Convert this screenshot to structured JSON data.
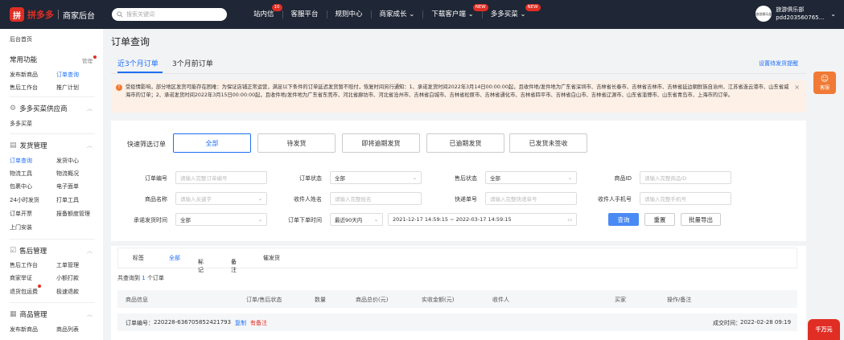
{
  "header": {
    "logo_mark": "拼",
    "logo_text": "拼多多",
    "logo_sub": "商家后台",
    "search_placeholder": "搜索关键词",
    "nav": [
      {
        "label": "站内信",
        "badge": "10"
      },
      {
        "label": "客服平台",
        "badge": ""
      },
      {
        "label": "规则中心",
        "badge": ""
      },
      {
        "label": "商家成长",
        "badge": ""
      },
      {
        "label": "下载客户端",
        "badge": "NEW"
      },
      {
        "label": "多多买菜",
        "badge": "NEW"
      }
    ],
    "nav_chevron": "⌄",
    "user": {
      "avatar_text": "旅游俱乐部",
      "name": "旅游俱乐部",
      "id": "pdd203560765..."
    }
  },
  "sidebar": {
    "home": "后台首页",
    "sections": [
      {
        "title": "常用功能",
        "icon": "",
        "extra": "管理",
        "items": [
          "发布新商品",
          "订单查询",
          "售后工作台",
          "推广计划"
        ]
      },
      {
        "title": "多多买菜供应商",
        "icon": "⚙",
        "items": [
          "多多买菜"
        ]
      },
      {
        "title": "发货管理",
        "icon": "▤",
        "items": [
          "订单查询",
          "发货中心",
          "物流工具",
          "物流概况",
          "包裹中心",
          "电子面单",
          "24小时发货",
          "打单工具",
          "订单开票",
          "报备额度管理",
          "上门安装"
        ]
      },
      {
        "title": "售后管理",
        "icon": "☑",
        "items": [
          "售后工作台",
          "工单管理",
          "商家举证",
          "小额打款",
          "退货包运费",
          "极速退款"
        ]
      },
      {
        "title": "商品管理",
        "icon": "▦",
        "items": [
          "发布新商品",
          "商品列表"
        ]
      }
    ]
  },
  "page": {
    "title": "订单查询",
    "tabs": [
      "近3个月订单",
      "3个月前订单"
    ],
    "tab_link": "设置待发货提醒",
    "notice": "受疫情影响，部分地区发货可能存在困难：为保证店铺正常运营，满足以下条件的订单延迟发货暂不赔付，恢复时间另行通知：1、承诺发货时间2022年3月14日00:00:00起，且收件地/发件地为广东省深圳市、吉林省长春市、吉林省吉林市、吉林省延边朝鲜族自治州、江苏省连云港市、山东省威海市的订单；2、承诺发货时间2022年3月15日00:00:00起，且收件地/发件地为广东省东莞市、河北省廊坊市、河北省沧州市、吉林省白城市、吉林省松原市、吉林省通化市、吉林省四平市、吉林省白山市、吉林省辽源市、山东省淄博市、山东省青岛市、上海市的订单。"
  },
  "filters": {
    "quick_label": "快速筛选订单",
    "quick": [
      "全部",
      "待发货",
      "即将逾期发货",
      "已逾期发货",
      "已发货未签收"
    ],
    "fields": {
      "order_no": {
        "label": "订单编号",
        "placeholder": "请输入完整订单编号"
      },
      "order_status": {
        "label": "订单状态",
        "value": "全部"
      },
      "after_sale_status": {
        "label": "售后状态",
        "value": "全部"
      },
      "product_id": {
        "label": "商品ID",
        "placeholder": "请输入完整商品ID"
      },
      "product_name": {
        "label": "商品名称",
        "placeholder": "请输入关键字"
      },
      "receiver_name": {
        "label": "收件人姓名",
        "placeholder": "请输入完整姓名"
      },
      "tracking_no": {
        "label": "快递单号",
        "placeholder": "请输入完整快递单号"
      },
      "receiver_phone": {
        "label": "收件人手机号",
        "placeholder": "请输入完整手机号"
      },
      "promise_time": {
        "label": "承诺发货时间",
        "value": "全部"
      },
      "order_time": {
        "label": "订单下单时间",
        "value": "最近90天内",
        "range": "2021-12-17 14:59:15 ~ 2022-03-17 14:59:15"
      }
    },
    "buttons": {
      "search": "查询",
      "reset": "重置",
      "export": "批量导出"
    }
  },
  "results": {
    "tag_bar": {
      "label": "标签",
      "all": "全部",
      "mark": "标记",
      "note": "备注",
      "urge": "催发货"
    },
    "count_prefix": "共查询到",
    "count": "1",
    "count_suffix": "个订单",
    "columns": [
      "商品信息",
      "订单/售后状态",
      "数量",
      "商品总价(元)",
      "实收金额(元)",
      "收件人",
      "买家",
      "操作/备注"
    ],
    "order": {
      "no_label": "订单编号：",
      "no": "220228-636705852421793",
      "copy": "复制",
      "has_note": "有备注",
      "time_label": "成交时间：",
      "time": "2022-02-28 09:19"
    }
  },
  "floating": {
    "service_icon": "☺",
    "service_label": "客服",
    "logo": "千万元"
  }
}
